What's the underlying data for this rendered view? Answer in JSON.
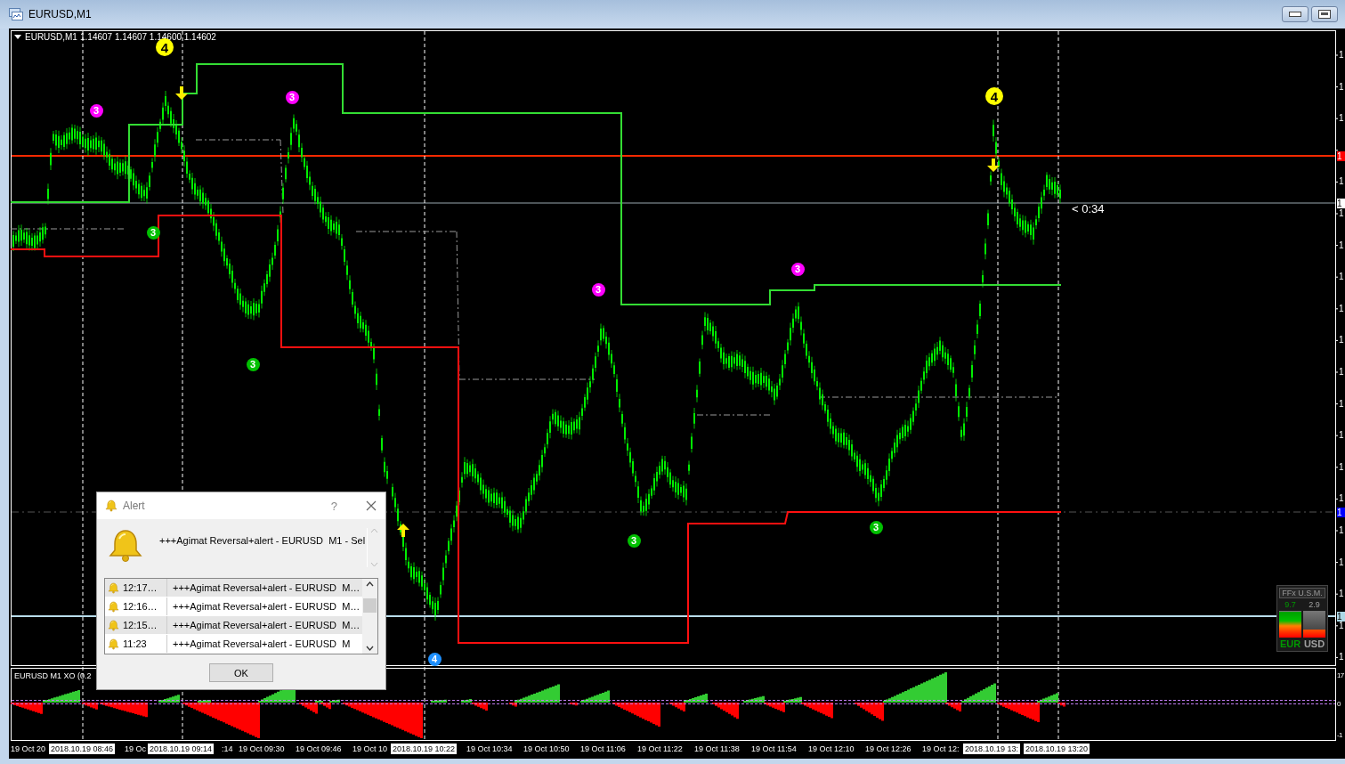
{
  "window": {
    "title": "EURUSD,M1"
  },
  "chart": {
    "symbol": "EURUSD,M1",
    "ohlc": "1.14607 1.14607 1.14600 1.14602",
    "countdown": "< 0:34",
    "signals": [
      {
        "label": "4",
        "color": "#ffff00"
      },
      {
        "label": "3",
        "color": "#ff00ff"
      },
      {
        "label": "3",
        "color": "#ff00ff"
      },
      {
        "label": "4",
        "color": "#ffff00"
      },
      {
        "label": "3",
        "color": "#00c000"
      },
      {
        "label": "3",
        "color": "#ff00ff"
      },
      {
        "label": "3",
        "color": "#ff00ff"
      },
      {
        "label": "3",
        "color": "#00c000"
      },
      {
        "label": "3",
        "color": "#00c000"
      },
      {
        "label": "3",
        "color": "#00c000"
      },
      {
        "label": "4",
        "color": "#1e90ff"
      }
    ],
    "price_axis": {
      "labels": [
        "1",
        "1",
        "1",
        "1",
        "1",
        "1",
        "1",
        "1",
        "1",
        "1",
        "1",
        "1",
        "1",
        "1",
        "1",
        "1",
        "1",
        "1",
        "1"
      ],
      "tags": [
        {
          "text": "1",
          "color": "#ff0000"
        },
        {
          "text": "1",
          "color": "#ffffff"
        },
        {
          "text": "1",
          "color": "#0000ff"
        },
        {
          "text": "1",
          "color": "#add8e6"
        }
      ]
    },
    "indicator": {
      "title": "EURUSD M1 XO (0.2",
      "axis_labels": [
        "17",
        "0",
        "-1"
      ]
    },
    "time_axis": [
      {
        "text": "19 Oct 20",
        "kind": "plain"
      },
      {
        "text": "2018.10.19 08:46",
        "kind": "marker"
      },
      {
        "text": "19 Oc",
        "kind": "plain"
      },
      {
        "text": "2018.10.19 09:14",
        "kind": "marker"
      },
      {
        "text": ":14",
        "kind": "plain"
      },
      {
        "text": "19 Oct 09:30",
        "kind": "plain"
      },
      {
        "text": "19 Oct 09:46",
        "kind": "plain"
      },
      {
        "text": "19 Oct 10",
        "kind": "plain"
      },
      {
        "text": "2018.10.19 10:22",
        "kind": "marker"
      },
      {
        "text": "19 Oct 10:34",
        "kind": "plain"
      },
      {
        "text": "19 Oct 10:50",
        "kind": "plain"
      },
      {
        "text": "19 Oct 11:06",
        "kind": "plain"
      },
      {
        "text": "19 Oct 11:22",
        "kind": "plain"
      },
      {
        "text": "19 Oct 11:38",
        "kind": "plain"
      },
      {
        "text": "19 Oct 11:54",
        "kind": "plain"
      },
      {
        "text": "19 Oct 12:10",
        "kind": "plain"
      },
      {
        "text": "19 Oct 12:26",
        "kind": "plain"
      },
      {
        "text": "19 Oct 12:",
        "kind": "plain"
      },
      {
        "text": "2018.10.19 13:",
        "kind": "marker"
      },
      {
        "text": "2018.10.19 13:20",
        "kind": "marker"
      }
    ]
  },
  "meter": {
    "title": "FFx U.S.M.",
    "bars": [
      {
        "value": "9.7",
        "currency": "EUR",
        "level": 0.97,
        "color": "#009900"
      },
      {
        "value": "2.9",
        "currency": "USD",
        "level": 0.29,
        "color": "#a0a0a0"
      }
    ]
  },
  "alert": {
    "title": "Alert",
    "help": "?",
    "message": "+++Agimat Reversal+alert - EURUSD  M1 - Sel",
    "rows": [
      {
        "time": "12:17…",
        "message": "+++Agimat Reversal+alert - EURUSD  M…"
      },
      {
        "time": "12:16…",
        "message": "+++Agimat Reversal+alert - EURUSD  M…"
      },
      {
        "time": "12:15…",
        "message": "+++Agimat Reversal+alert - EURUSD  M…"
      },
      {
        "time": "11:23",
        "message": "+++Agimat Reversal+alert - EURUSD  M"
      }
    ],
    "ok": "OK"
  }
}
